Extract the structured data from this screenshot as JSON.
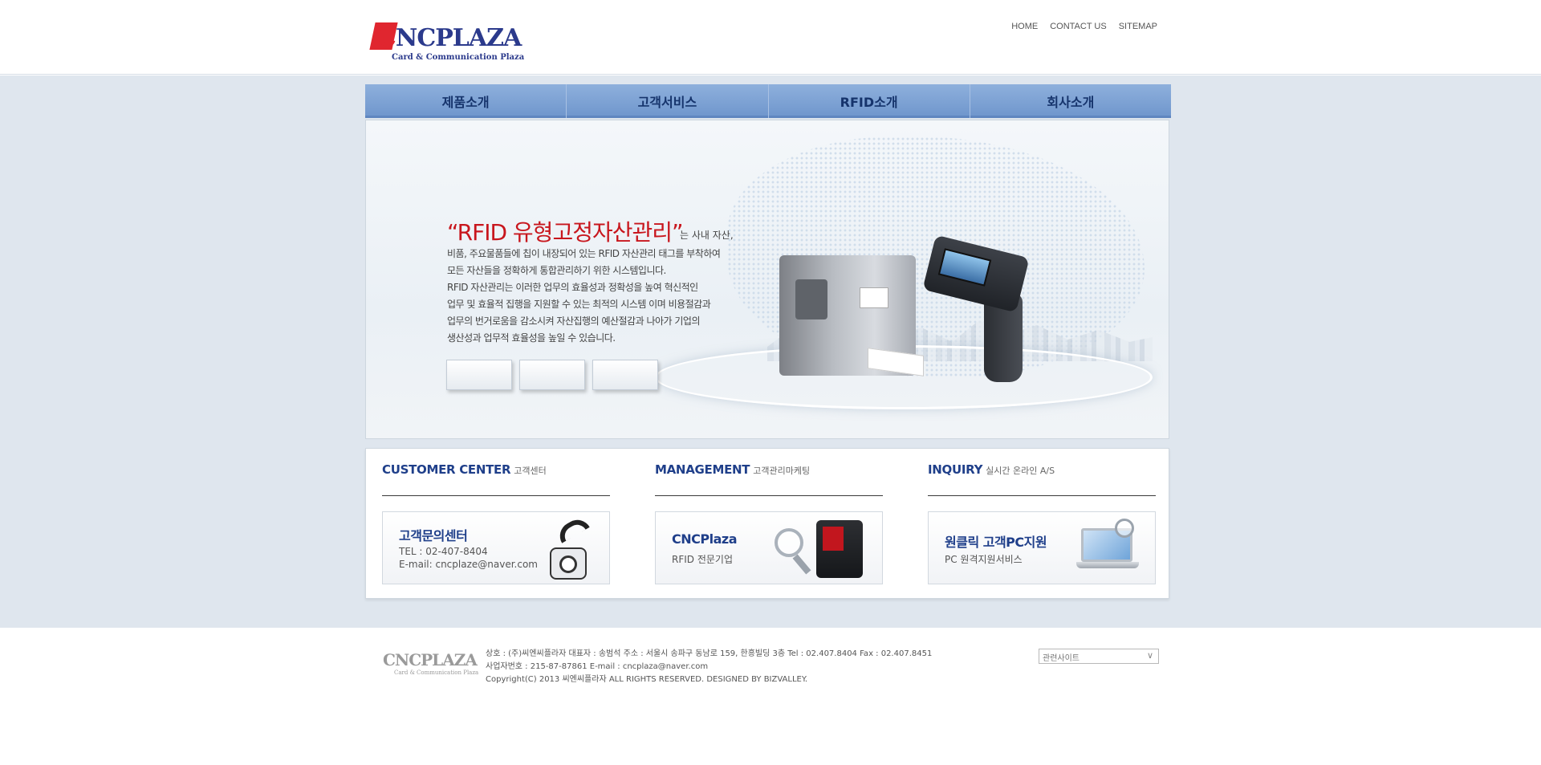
{
  "header": {
    "logo": {
      "brand_prefix": "C",
      "brand_rest": "NCPLAZA",
      "tagline": "Card & Communication Plaza"
    },
    "top_links": [
      "HOME",
      "CONTACT US",
      "SITEMAP"
    ]
  },
  "gnb": {
    "items": [
      "제품소개",
      "고객서비스",
      "RFID소개",
      "회사소개"
    ]
  },
  "visual": {
    "headline": "“RFID 유형고정자산관리”",
    "headline_tail": "는 사내 자산,",
    "lines": [
      "비품, 주요물품들에 칩이 내장되어 있는 RFID 자산관리 태그를 부착하여",
      "모든 자산들을 정확하게 통합관리하기 위한 시스템입니다.",
      "RFID  자산관리는 이러한 업무의 효율성과 정확성을 높여 혁신적인",
      "업무 및 효율적 집행을 지원할 수 있는 최적의 시스템 이며 비용절감과",
      "업무의 번거로움을 감소시켜 자산집행의 예산절감과 나아가 기업의",
      "생산성과 업무적 효율성을 높일 수 있습니다."
    ]
  },
  "panel": {
    "customer": {
      "title": "CUSTOMER CENTER",
      "subtitle": "고객센터",
      "card_title": "고객문의센터",
      "tel": "TEL : 02-407-8404",
      "email": "E-mail: cncplaze@naver.com"
    },
    "management": {
      "title": "MANAGEMENT",
      "subtitle": "고객관리마케팅",
      "card_title": "CNCPlaza",
      "card_sub": "RFID 전문기업"
    },
    "inquiry": {
      "title": "INQUIRY",
      "subtitle": "실시간 온라인 A/S",
      "card_title": "원클릭 고객PC지원",
      "card_sub": "PC 원격지원서비스"
    }
  },
  "footer": {
    "logo": {
      "brand": "CNCPLAZA",
      "tagline": "Card & Communication Plaza"
    },
    "line1": "상호 : (주)씨엔씨플라자     대표자 : 송범석     주소 : 서울시 송파구 동남로 159, 한흥빌딩 3층     Tel : 02.407.8404     Fax : 02.407.8451",
    "line2": "사업자번호 : 215-87-87861     E-mail : cncplaza@naver.com",
    "line3": "Copyright(C) 2013 씨엔씨플라자     ALL RIGHTS RESERVED. DESIGNED BY BIZVALLEY.",
    "select_value": "관련사이트"
  }
}
